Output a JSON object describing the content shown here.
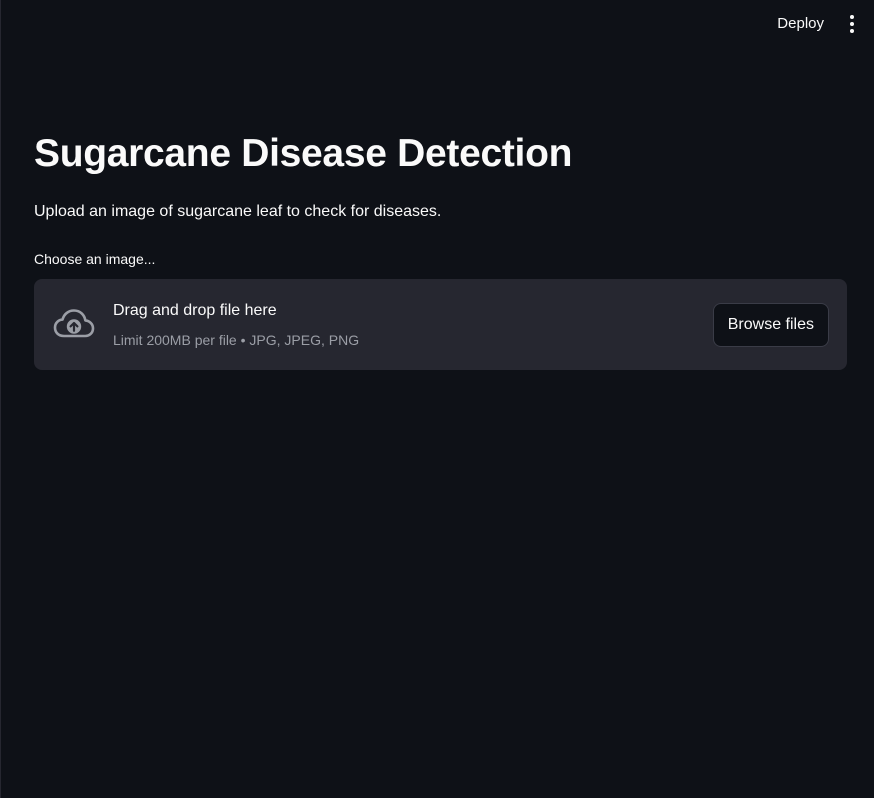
{
  "header": {
    "deploy_label": "Deploy",
    "menu_icon": "vertical-ellipsis-icon"
  },
  "main": {
    "title": "Sugarcane Disease Detection",
    "subtitle": "Upload an image of sugarcane leaf to check for diseases.",
    "uploader": {
      "label": "Choose an image...",
      "icon": "cloud-upload-icon",
      "drop_text": "Drag and drop file here",
      "limit_text": "Limit 200MB per file • JPG, JPEG, PNG",
      "browse_label": "Browse files"
    }
  },
  "colors": {
    "background": "#0e1117",
    "dropzone": "#262730",
    "text": "#fafafa",
    "muted_text": "#9b9ea6"
  }
}
